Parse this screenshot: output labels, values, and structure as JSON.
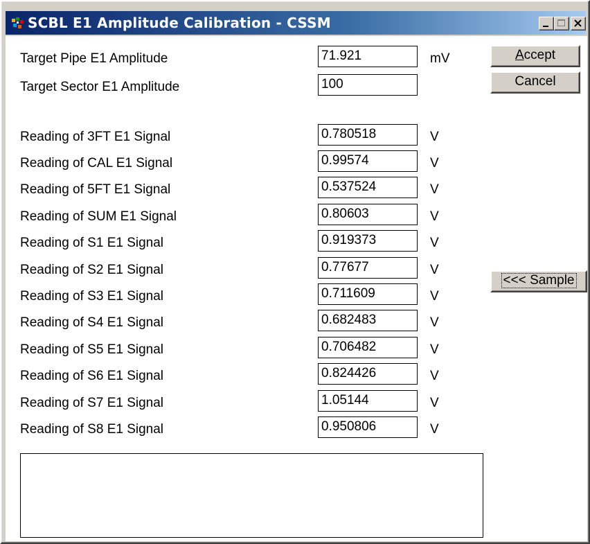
{
  "window": {
    "title": "SCBL E1 Amplitude Calibration - CSSM",
    "icon": "cssm-app-icon"
  },
  "targets": [
    {
      "label": "Target Pipe E1 Amplitude",
      "value": "71.921",
      "unit": "mV"
    },
    {
      "label": "Target Sector E1 Amplitude",
      "value": "100",
      "unit": ""
    }
  ],
  "readings": [
    {
      "label": "Reading of 3FT E1 Signal",
      "value": "0.780518",
      "unit": "V"
    },
    {
      "label": "Reading of CAL E1 Signal",
      "value": "0.99574",
      "unit": "V"
    },
    {
      "label": "Reading of 5FT E1 Signal",
      "value": "0.537524",
      "unit": "V"
    },
    {
      "label": "Reading of SUM E1 Signal",
      "value": "0.80603",
      "unit": "V"
    },
    {
      "label": "Reading of S1 E1 Signal",
      "value": "0.919373",
      "unit": "V"
    },
    {
      "label": "Reading of S2 E1 Signal",
      "value": "0.77677",
      "unit": "V"
    },
    {
      "label": "Reading of S3 E1 Signal",
      "value": "0.711609",
      "unit": "V"
    },
    {
      "label": "Reading of S4 E1 Signal",
      "value": "0.682483",
      "unit": "V"
    },
    {
      "label": "Reading of S5 E1 Signal",
      "value": "0.706482",
      "unit": "V"
    },
    {
      "label": "Reading of S6 E1 Signal",
      "value": "0.824426",
      "unit": "V"
    },
    {
      "label": "Reading of S7 E1 Signal",
      "value": "1.05144",
      "unit": "V"
    },
    {
      "label": "Reading of S8 E1 Signal",
      "value": "0.950806",
      "unit": "V"
    }
  ],
  "buttons": {
    "accept_label": "Accept",
    "cancel_label": "Cancel",
    "sample_label": "<<< Sample"
  },
  "message_box": {
    "text": ""
  }
}
